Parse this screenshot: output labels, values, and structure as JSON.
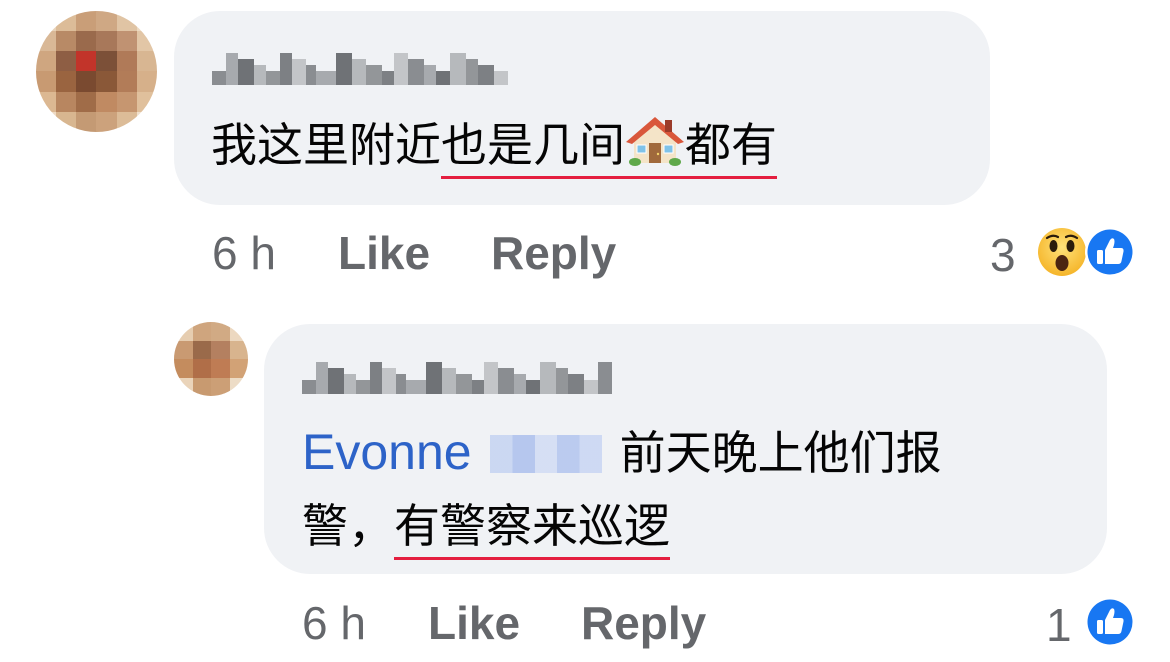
{
  "comments": [
    {
      "text_plain": "我这里附近",
      "text_underlined": "也是几间",
      "emoji": "house-icon",
      "text_underlined_after": "都有",
      "time": "6 h",
      "like_label": "Like",
      "reply_label": "Reply",
      "reaction_count": "3",
      "reactions": [
        "wow-icon",
        "like-icon"
      ]
    },
    {
      "mention_name": "Evonne",
      "line1_text": "前天晚上他们报",
      "line2_plain": "警，",
      "line2_underlined": "有警察来巡逻",
      "time": "6 h",
      "like_label": "Like",
      "reply_label": "Reply",
      "reaction_count": "1",
      "reactions": [
        "like-icon"
      ]
    }
  ],
  "colors": {
    "bubble_bg": "#f0f2f5",
    "mention": "#2d63c8",
    "underline": "#e41e3f",
    "meta_text": "#65676b",
    "like_blue": "#1877f2"
  }
}
